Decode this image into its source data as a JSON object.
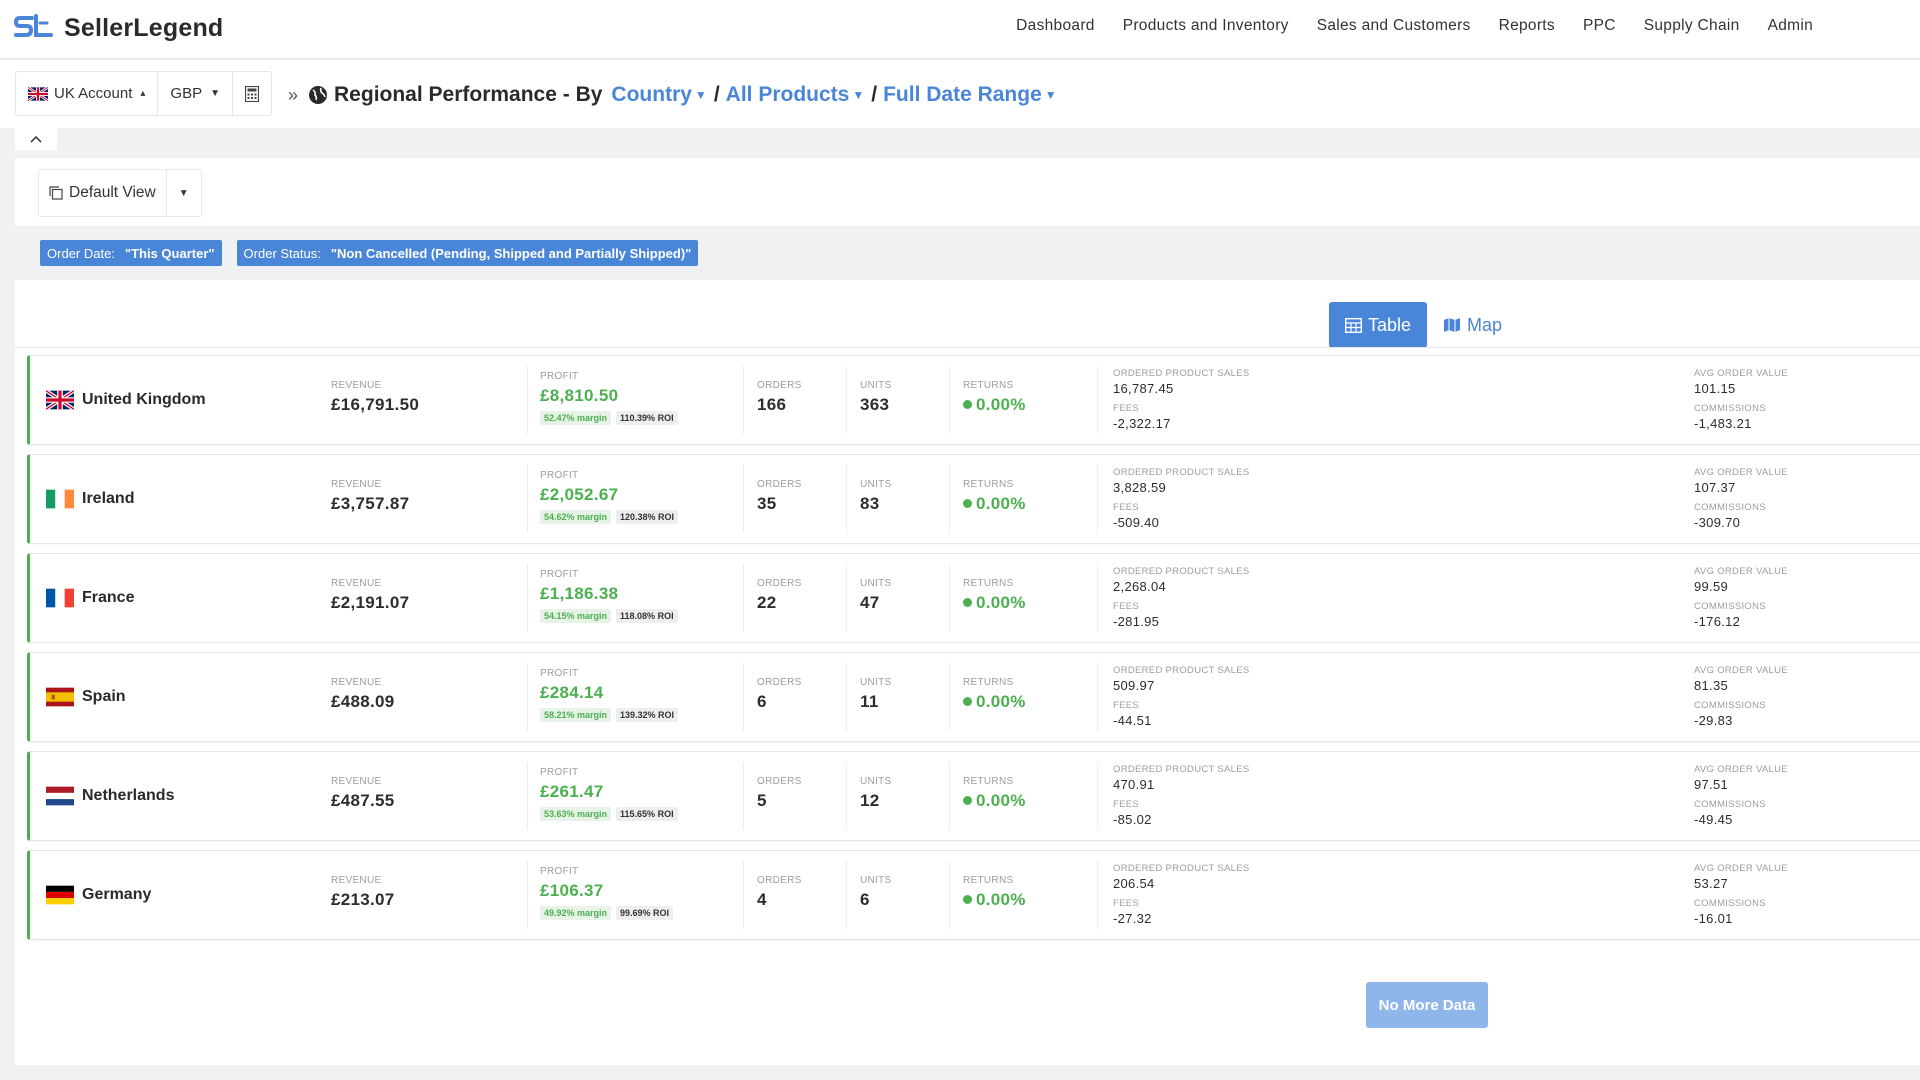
{
  "app": {
    "brand": "SellerLegend"
  },
  "nav": {
    "items": [
      "Dashboard",
      "Products and Inventory",
      "Sales and Customers",
      "Reports",
      "PPC",
      "Supply Chain",
      "Admin"
    ]
  },
  "toolbar": {
    "account": "UK Account",
    "currency": "GBP",
    "calculator_icon": "calculator-icon"
  },
  "breadcrumb": {
    "separator": "»",
    "title": "Regional Performance - By",
    "group_by": "Country",
    "products": "All Products",
    "date_range": "Full Date Range",
    "slash": "/"
  },
  "view": {
    "label": "Default View"
  },
  "filters": [
    {
      "key": "Order Date:",
      "value": "\"This Quarter\""
    },
    {
      "key": "Order Status:",
      "value": "\"Non Cancelled (Pending, Shipped and Partially Shipped)\""
    }
  ],
  "toggle": {
    "table": "Table",
    "map": "Map"
  },
  "labels": {
    "revenue": "REVENUE",
    "profit": "PROFIT",
    "orders": "ORDERS",
    "units": "UNITS",
    "returns": "RETURNS",
    "ordered_product_sales": "ORDERED PRODUCT SALES",
    "fees": "FEES",
    "avg_order_value": "AVG ORDER VALUE",
    "commissions": "COMMISSIONS"
  },
  "rows": [
    {
      "country": "United Kingdom",
      "flag": "uk",
      "revenue": "£16,791.50",
      "profit": "£8,810.50",
      "margin": "52.47% margin",
      "roi": "110.39% ROI",
      "orders": "166",
      "units": "363",
      "returns": "0.00%",
      "ops": "16,787.45",
      "fees": "-2,322.17",
      "aov": "101.15",
      "commissions": "-1,483.21"
    },
    {
      "country": "Ireland",
      "flag": "ie",
      "revenue": "£3,757.87",
      "profit": "£2,052.67",
      "margin": "54.62% margin",
      "roi": "120.38% ROI",
      "orders": "35",
      "units": "83",
      "returns": "0.00%",
      "ops": "3,828.59",
      "fees": "-509.40",
      "aov": "107.37",
      "commissions": "-309.70"
    },
    {
      "country": "France",
      "flag": "fr",
      "revenue": "£2,191.07",
      "profit": "£1,186.38",
      "margin": "54.15% margin",
      "roi": "118.08% ROI",
      "orders": "22",
      "units": "47",
      "returns": "0.00%",
      "ops": "2,268.04",
      "fees": "-281.95",
      "aov": "99.59",
      "commissions": "-176.12"
    },
    {
      "country": "Spain",
      "flag": "es",
      "revenue": "£488.09",
      "profit": "£284.14",
      "margin": "58.21% margin",
      "roi": "139.32% ROI",
      "orders": "6",
      "units": "11",
      "returns": "0.00%",
      "ops": "509.97",
      "fees": "-44.51",
      "aov": "81.35",
      "commissions": "-29.83"
    },
    {
      "country": "Netherlands",
      "flag": "nl",
      "revenue": "£487.55",
      "profit": "£261.47",
      "margin": "53.63% margin",
      "roi": "115.65% ROI",
      "orders": "5",
      "units": "12",
      "returns": "0.00%",
      "ops": "470.91",
      "fees": "-85.02",
      "aov": "97.51",
      "commissions": "-49.45"
    },
    {
      "country": "Germany",
      "flag": "de",
      "revenue": "£213.07",
      "profit": "£106.37",
      "margin": "49.92% margin",
      "roi": "99.69% ROI",
      "orders": "4",
      "units": "6",
      "returns": "0.00%",
      "ops": "206.54",
      "fees": "-27.32",
      "aov": "53.27",
      "commissions": "-16.01"
    }
  ],
  "footer": {
    "no_more": "No More Data"
  },
  "colors": {
    "accent": "#4a86d8",
    "positive": "#4caf50",
    "no_more_button": "#8fb6ea"
  }
}
